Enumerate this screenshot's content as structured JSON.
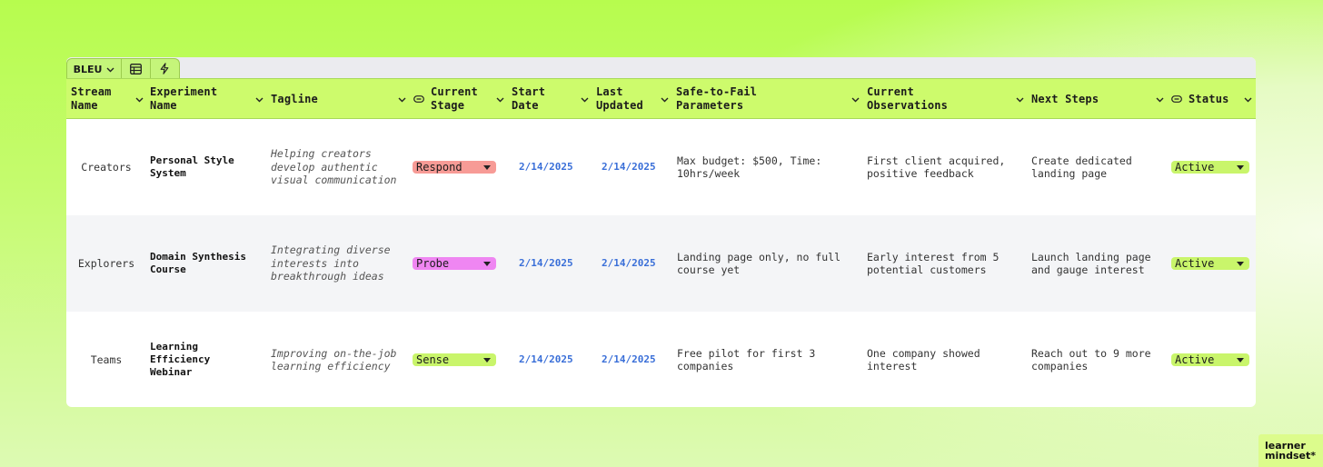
{
  "toolbar": {
    "view_name": "BLEU",
    "icons": [
      "chevron-down-icon",
      "grid-icon",
      "lightning-icon"
    ]
  },
  "columns": [
    {
      "label": "Stream\nName",
      "icon": "chevron-down-icon"
    },
    {
      "label": "Experiment\nName",
      "icon": "chevron-down-icon"
    },
    {
      "label": "Tagline",
      "icon": "chevron-down-icon"
    },
    {
      "label": "Current\nStage",
      "icon": "link-icon"
    },
    {
      "label": "Start\nDate",
      "icon": "chevron-down-icon"
    },
    {
      "label": "Last\nUpdated",
      "icon": "chevron-down-icon"
    },
    {
      "label": "Safe-to-Fail\nParameters",
      "icon": "chevron-down-icon"
    },
    {
      "label": "Current\nObservations",
      "icon": "chevron-down-icon"
    },
    {
      "label": "Next Steps",
      "icon": "chevron-down-icon"
    },
    {
      "label": "Status",
      "icon": "link-icon"
    }
  ],
  "rows": [
    {
      "stream": "Creators",
      "experiment": "Personal Style System",
      "tagline": "Helping creators develop authentic visual communication",
      "stage": "Respond",
      "stage_color": "#f79b96",
      "start_date": "2/14/2025",
      "last_updated": "2/14/2025",
      "parameters": "Max budget: $500, Time: 10hrs/week",
      "observations": "First client acquired, positive feedback",
      "next_steps": "Create dedicated landing page",
      "status": "Active",
      "status_color": "#c9f56b"
    },
    {
      "stream": "Explorers",
      "experiment": "Domain Synthesis Course",
      "tagline": "Integrating diverse interests into breakthrough ideas",
      "stage": "Probe",
      "stage_color": "#ef86f2",
      "start_date": "2/14/2025",
      "last_updated": "2/14/2025",
      "parameters": "Landing page only, no full course yet",
      "observations": "Early interest from 5 potential customers",
      "next_steps": "Launch landing page and gauge interest",
      "status": "Active",
      "status_color": "#c9f56b"
    },
    {
      "stream": "Teams",
      "experiment": "Learning Efficiency Webinar",
      "tagline": "Improving on-the-job learning efficiency",
      "stage": "Sense",
      "stage_color": "#c9f56b",
      "start_date": "2/14/2025",
      "last_updated": "2/14/2025",
      "parameters": "Free pilot for first 3 companies",
      "observations": "One company showed interest",
      "next_steps": "Reach out to 9 more companies",
      "status": "Active",
      "status_color": "#c9f56b"
    }
  ],
  "brand": {
    "logo_line1": "learner",
    "logo_line2": "mindset*"
  },
  "colors": {
    "background": "#b7fc4e",
    "header": "#cdfb6c",
    "date_link": "#3a6fd8"
  }
}
